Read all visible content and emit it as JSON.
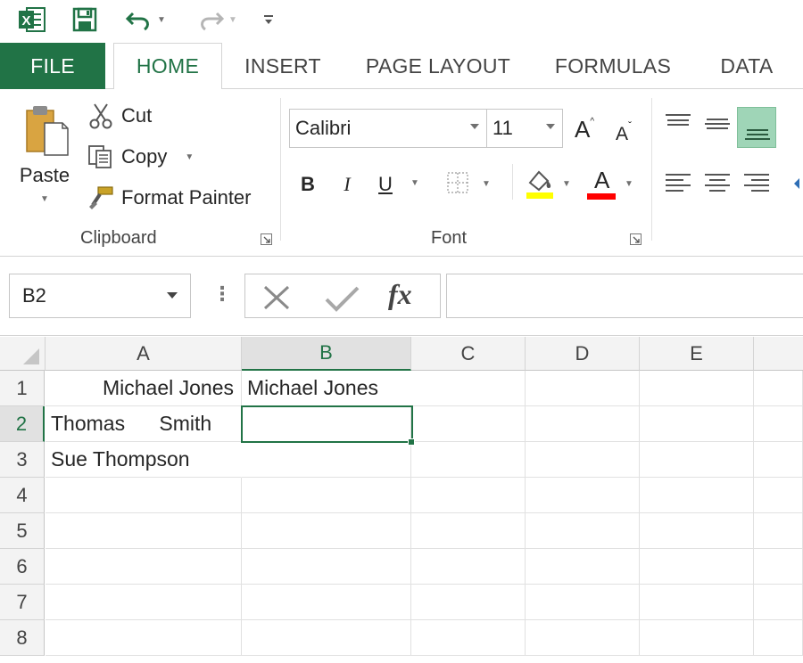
{
  "qat": {
    "app_icon": "excel-logo-icon",
    "app_letter": "X",
    "save_icon": "save-icon",
    "undo_icon": "undo-icon",
    "redo_icon": "redo-icon",
    "customize_icon": "customize-qat-icon"
  },
  "tabs": [
    "FILE",
    "HOME",
    "INSERT",
    "PAGE LAYOUT",
    "FORMULAS",
    "DATA"
  ],
  "active_tab": "HOME",
  "clipboard": {
    "paste_label": "Paste",
    "cut_label": "Cut",
    "copy_label": "Copy",
    "format_painter_label": "Format Painter",
    "group_label": "Clipboard"
  },
  "font": {
    "name": "Calibri",
    "size": "11",
    "bold": "B",
    "italic": "I",
    "underline": "U",
    "grow": "A",
    "shrink": "A",
    "font_color_letter": "A",
    "group_label": "Font",
    "fill_color": "#ffff00",
    "font_color": "#ff0000"
  },
  "formula_bar": {
    "name_box": "B2",
    "more": "⋮",
    "cancel_icon": "cancel-icon",
    "enter_icon": "enter-icon",
    "fx_label": "fx",
    "formula_value": ""
  },
  "grid": {
    "columns": [
      "A",
      "B",
      "C",
      "D",
      "E"
    ],
    "selected_column": "B",
    "rows": [
      "1",
      "2",
      "3",
      "4",
      "5",
      "6",
      "7",
      "8"
    ],
    "selected_row": "2",
    "cells": {
      "A1": "Michael Jones",
      "B1": "Michael Jones",
      "A2": "Thomas      Smith",
      "A3": "Sue Thompson"
    }
  },
  "colors": {
    "accent": "#217346",
    "selection": "#217346"
  }
}
